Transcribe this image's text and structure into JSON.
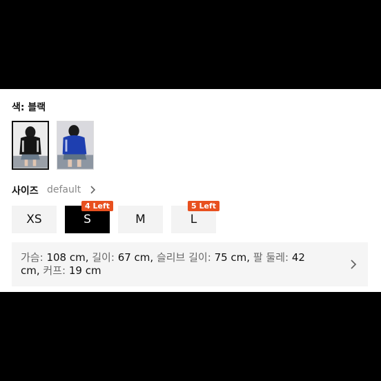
{
  "color": {
    "label": "색: 블랙",
    "swatches": [
      {
        "name": "black",
        "selected": true
      },
      {
        "name": "blue",
        "selected": false
      }
    ]
  },
  "size": {
    "label": "사이즈",
    "chart_label": "default",
    "chevron_icon": "chevron-right-icon",
    "options": [
      {
        "label": "XS",
        "selected": false,
        "badge": ""
      },
      {
        "label": "S",
        "selected": true,
        "badge": "4 Left"
      },
      {
        "label": "M",
        "selected": false,
        "badge": ""
      },
      {
        "label": "L",
        "selected": false,
        "badge": "5 Left"
      }
    ]
  },
  "measurements": {
    "chest_label": "가슴:",
    "chest_value": "108 cm,",
    "length_label": "길이:",
    "length_value": "67 cm,",
    "sleeve_label": "슬리브 길이:",
    "sleeve_value": "75 cm,",
    "arm_label": "팔 둘레:",
    "arm_value": "42 cm,",
    "cuff_label": "커프:",
    "cuff_value": "19 cm",
    "chevron_icon": "chevron-right-icon"
  },
  "colors": {
    "badge": "#e8501f",
    "selected": "#000000",
    "unselected": "#f3f3f3"
  }
}
